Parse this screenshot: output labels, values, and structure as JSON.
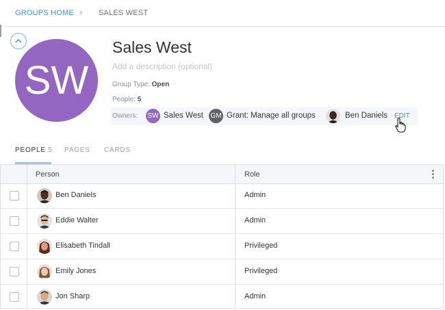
{
  "breadcrumb": {
    "home": "GROUPS HOME",
    "separator": "›",
    "current": "SALES WEST"
  },
  "group": {
    "initials": "SW",
    "name": "Sales West",
    "description_placeholder": "Add a description (optional)",
    "type_label": "Group Type:",
    "type_value": "Open",
    "people_label": "People:",
    "people_value": "5",
    "avatar_color": "#9366c2"
  },
  "owners": {
    "label": "Owners:",
    "items": [
      {
        "initials": "SW",
        "name": "Sales West",
        "color": "#9366c2"
      },
      {
        "initials": "GM",
        "name": "Grant: Manage all groups",
        "color": "#5f6163"
      },
      {
        "initials": "",
        "name": "Ben Daniels",
        "color": "#3b2a22"
      }
    ],
    "edit_label": "EDIT"
  },
  "tabs": [
    {
      "label": "PEOPLE",
      "count": "5",
      "active": true
    },
    {
      "label": "PAGES",
      "count": "",
      "active": false
    },
    {
      "label": "CARDS",
      "count": "",
      "active": false
    }
  ],
  "table": {
    "columns": [
      "Person",
      "Role"
    ],
    "rows": [
      {
        "name": "Ben Daniels",
        "role": "Admin",
        "skin": "#4a3024",
        "hair": "#1a1210"
      },
      {
        "name": "Eddie Walter",
        "role": "Admin",
        "skin": "#e7b690",
        "hair": "#2b2119"
      },
      {
        "name": "Elisabeth Tindall",
        "role": "Privileged",
        "skin": "#d99f7e",
        "hair": "#5a2d1d"
      },
      {
        "name": "Emily Jones",
        "role": "Privileged",
        "skin": "#f0c7ae",
        "hair": "#7a5a3a"
      },
      {
        "name": "Jon Sharp",
        "role": "Admin",
        "skin": "#d8a983",
        "hair": "#3b2f28"
      }
    ]
  },
  "colors": {
    "accent": "#4a90c4",
    "tab_underline": "#9ec4e4"
  }
}
